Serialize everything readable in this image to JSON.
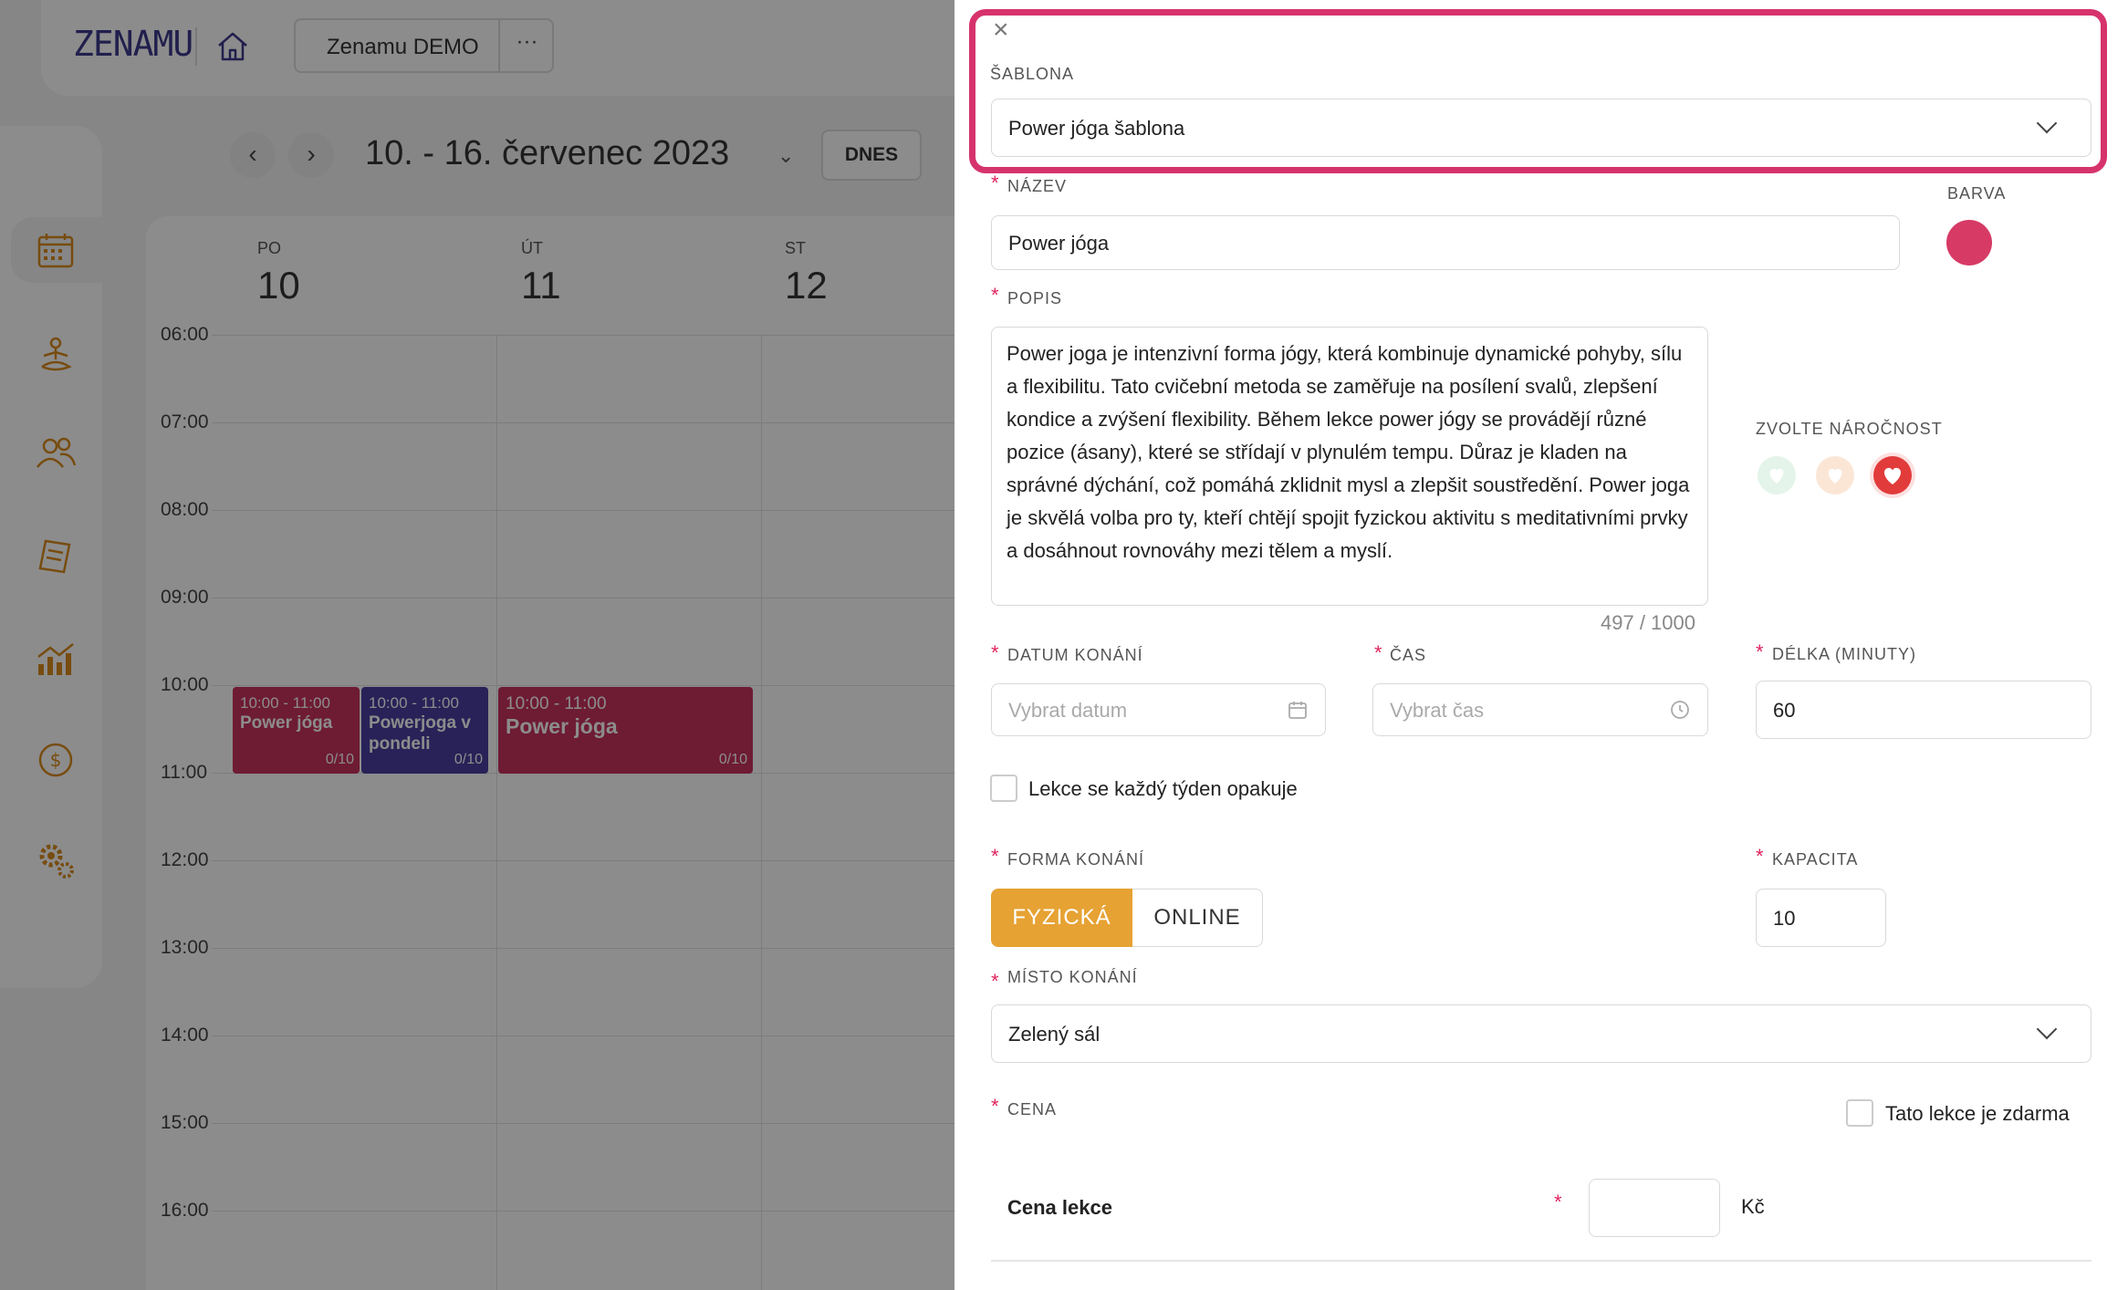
{
  "app": {
    "logo": "ZENAMU",
    "org_name": "Zenamu DEMO",
    "org_more": "···"
  },
  "calendar": {
    "week_title": "10. - 16. červenec 2023",
    "today_label": "DNES",
    "days": [
      {
        "name": "PO",
        "num": "10"
      },
      {
        "name": "ÚT",
        "num": "11"
      },
      {
        "name": "ST",
        "num": "12"
      }
    ],
    "hours": [
      "06:00",
      "07:00",
      "08:00",
      "09:00",
      "10:00",
      "11:00",
      "12:00",
      "13:00",
      "14:00",
      "15:00",
      "16:00"
    ],
    "events": [
      {
        "time": "10:00 - 11:00",
        "title": "Power jóga",
        "capacity": "0/10",
        "color": "#c8325f"
      },
      {
        "time": "10:00 - 11:00",
        "title": "Powerjoga v pondeli",
        "capacity": "0/10",
        "color": "#4a3fa0"
      },
      {
        "time": "10:00 - 11:00",
        "title": "Power jóga",
        "capacity": "0/10",
        "color": "#c8325f"
      }
    ],
    "nav_icons": [
      "calendar-icon",
      "yoga-icon",
      "clients-icon",
      "documents-icon",
      "stats-icon",
      "money-icon",
      "settings-icon"
    ]
  },
  "form": {
    "template": {
      "label": "ŠABLONA",
      "value": "Power jóga šablona"
    },
    "name": {
      "label": "NÁZEV",
      "value": "Power jóga"
    },
    "color": {
      "label": "BARVA",
      "value": "#d63a65"
    },
    "description": {
      "label": "POPIS",
      "value": "Power joga je intenzivní forma jógy, která kombinuje dynamické pohyby, sílu a flexibilitu. Tato cvičební metoda se zaměřuje na posílení svalů, zlepšení kondice a zvýšení flexibility. Během lekce power jógy se provádějí různé pozice (ásany), které se střídají v plynulém tempu. Důraz je kladen na správné dýchání, což pomáhá zklidnit mysl a zlepšit soustředění. Power joga je skvělá volba pro ty, kteří chtějí spojit fyzickou aktivitu s meditativními prvky a dosáhnout rovnováhy mezi tělem a myslí.",
      "counter": "497 / 1000"
    },
    "difficulty": {
      "label": "ZVOLTE NÁROČNOST",
      "selected": 3
    },
    "date": {
      "label": "DATUM KONÁNÍ",
      "placeholder": "Vybrat datum"
    },
    "time": {
      "label": "ČAS",
      "placeholder": "Vybrat čas"
    },
    "duration": {
      "label": "DÉLKA (MINUTY)",
      "value": "60"
    },
    "repeat": {
      "label": "Lekce se každý týden opakuje",
      "checked": false
    },
    "form_type": {
      "label": "FORMA KONÁNÍ",
      "options": [
        "FYZICKÁ",
        "ONLINE"
      ],
      "selected": "FYZICKÁ"
    },
    "capacity": {
      "label": "KAPACITA",
      "value": "10"
    },
    "location": {
      "label": "MÍSTO KONÁNÍ",
      "value": "Zelený sál"
    },
    "price": {
      "label": "CENA",
      "free_label": "Tato lekce je zdarma",
      "free_checked": false,
      "lesson_price_label": "Cena lekce",
      "lesson_price_value": "",
      "currency": "Kč"
    },
    "required_mark": "*",
    "close_symbol": "×"
  }
}
